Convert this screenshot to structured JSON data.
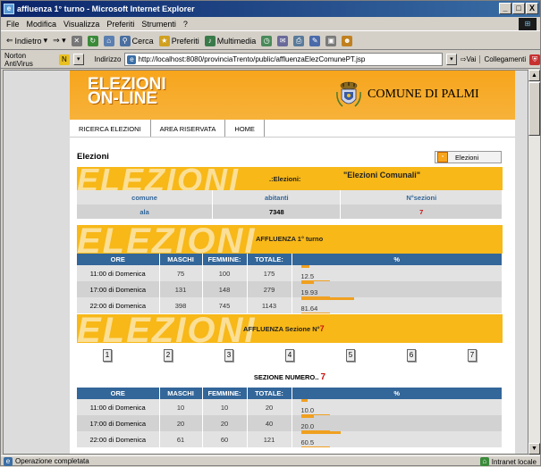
{
  "window": {
    "title": "affluenza 1° turno - Microsoft Internet Explorer",
    "buttons": [
      "_",
      "□",
      "X"
    ]
  },
  "menu": [
    "File",
    "Modifica",
    "Visualizza",
    "Preferiti",
    "Strumenti",
    "?"
  ],
  "toolbar": {
    "back": "Indietro",
    "search": "Cerca",
    "favorites": "Preferiti",
    "multimedia": "Multimedia"
  },
  "addressbar": {
    "norton": "Norton AntiVirus",
    "label": "Indirizzo",
    "url": "http://localhost:8080/provinciaTrento/public/affluenzaElezComunePT.jsp",
    "go": "Vai",
    "links": "Collegamenti"
  },
  "status": {
    "text": "Operazione completata",
    "zone": "Intranet locale"
  },
  "page": {
    "logo_line1": "ELEZIONI",
    "logo_line2": "ON-LINE",
    "comune": "COMUNE DI PALMI",
    "nav": [
      "RICERCA ELEZIONI",
      "AREA RISERVATA",
      "HOME"
    ],
    "section_title": "Elezioni",
    "elezioni_button": "Elezioni",
    "watermark": "ELEZIONI",
    "info": {
      "label": ".:Elezioni:",
      "election": "\"Elezioni Comunali\"",
      "headers": [
        "comune",
        "abitanti",
        "N°sezioni"
      ],
      "row": [
        "ala",
        "7348",
        "7"
      ]
    },
    "affluenza": {
      "title": "AFFLUENZA 1° turno",
      "headers": [
        "ORE",
        "MASCHI",
        "FEMMINE:",
        "TOTALE:",
        "%"
      ],
      "rows": [
        {
          "ore": "11:00 di Domenica",
          "m": "75",
          "f": "100",
          "t": "175",
          "pct": "12.5",
          "frac": 0.125
        },
        {
          "ore": "17:00 di Domenica",
          "m": "131",
          "f": "148",
          "t": "279",
          "pct": "19.93",
          "frac": 0.1993
        },
        {
          "ore": "22:00 di Domenica",
          "m": "398",
          "f": "745",
          "t": "1143",
          "pct": "81.64",
          "frac": 0.8164
        }
      ]
    },
    "sezione": {
      "title": "AFFLUENZA Sezione N°",
      "title_num": "7",
      "buttons": [
        "1",
        "2",
        "3",
        "4",
        "5",
        "6",
        "7"
      ],
      "numero_label": "SEZIONE NUMERO..",
      "numero": "7",
      "headers": [
        "ORE",
        "MASCHI",
        "FEMMINE:",
        "TOTALE:",
        "%"
      ],
      "rows": [
        {
          "ore": "11:00 di Domenica",
          "m": "10",
          "f": "10",
          "t": "20",
          "pct": "10.0",
          "frac": 0.1
        },
        {
          "ore": "17:00 di Domenica",
          "m": "20",
          "f": "20",
          "t": "40",
          "pct": "20.0",
          "frac": 0.2
        },
        {
          "ore": "22:00 di Domenica",
          "m": "61",
          "f": "60",
          "t": "121",
          "pct": "60.5",
          "frac": 0.605
        }
      ]
    }
  },
  "colors": {
    "header_orange": "#f7a51c",
    "table_header": "#336699",
    "accent_red": "#cc1111"
  }
}
